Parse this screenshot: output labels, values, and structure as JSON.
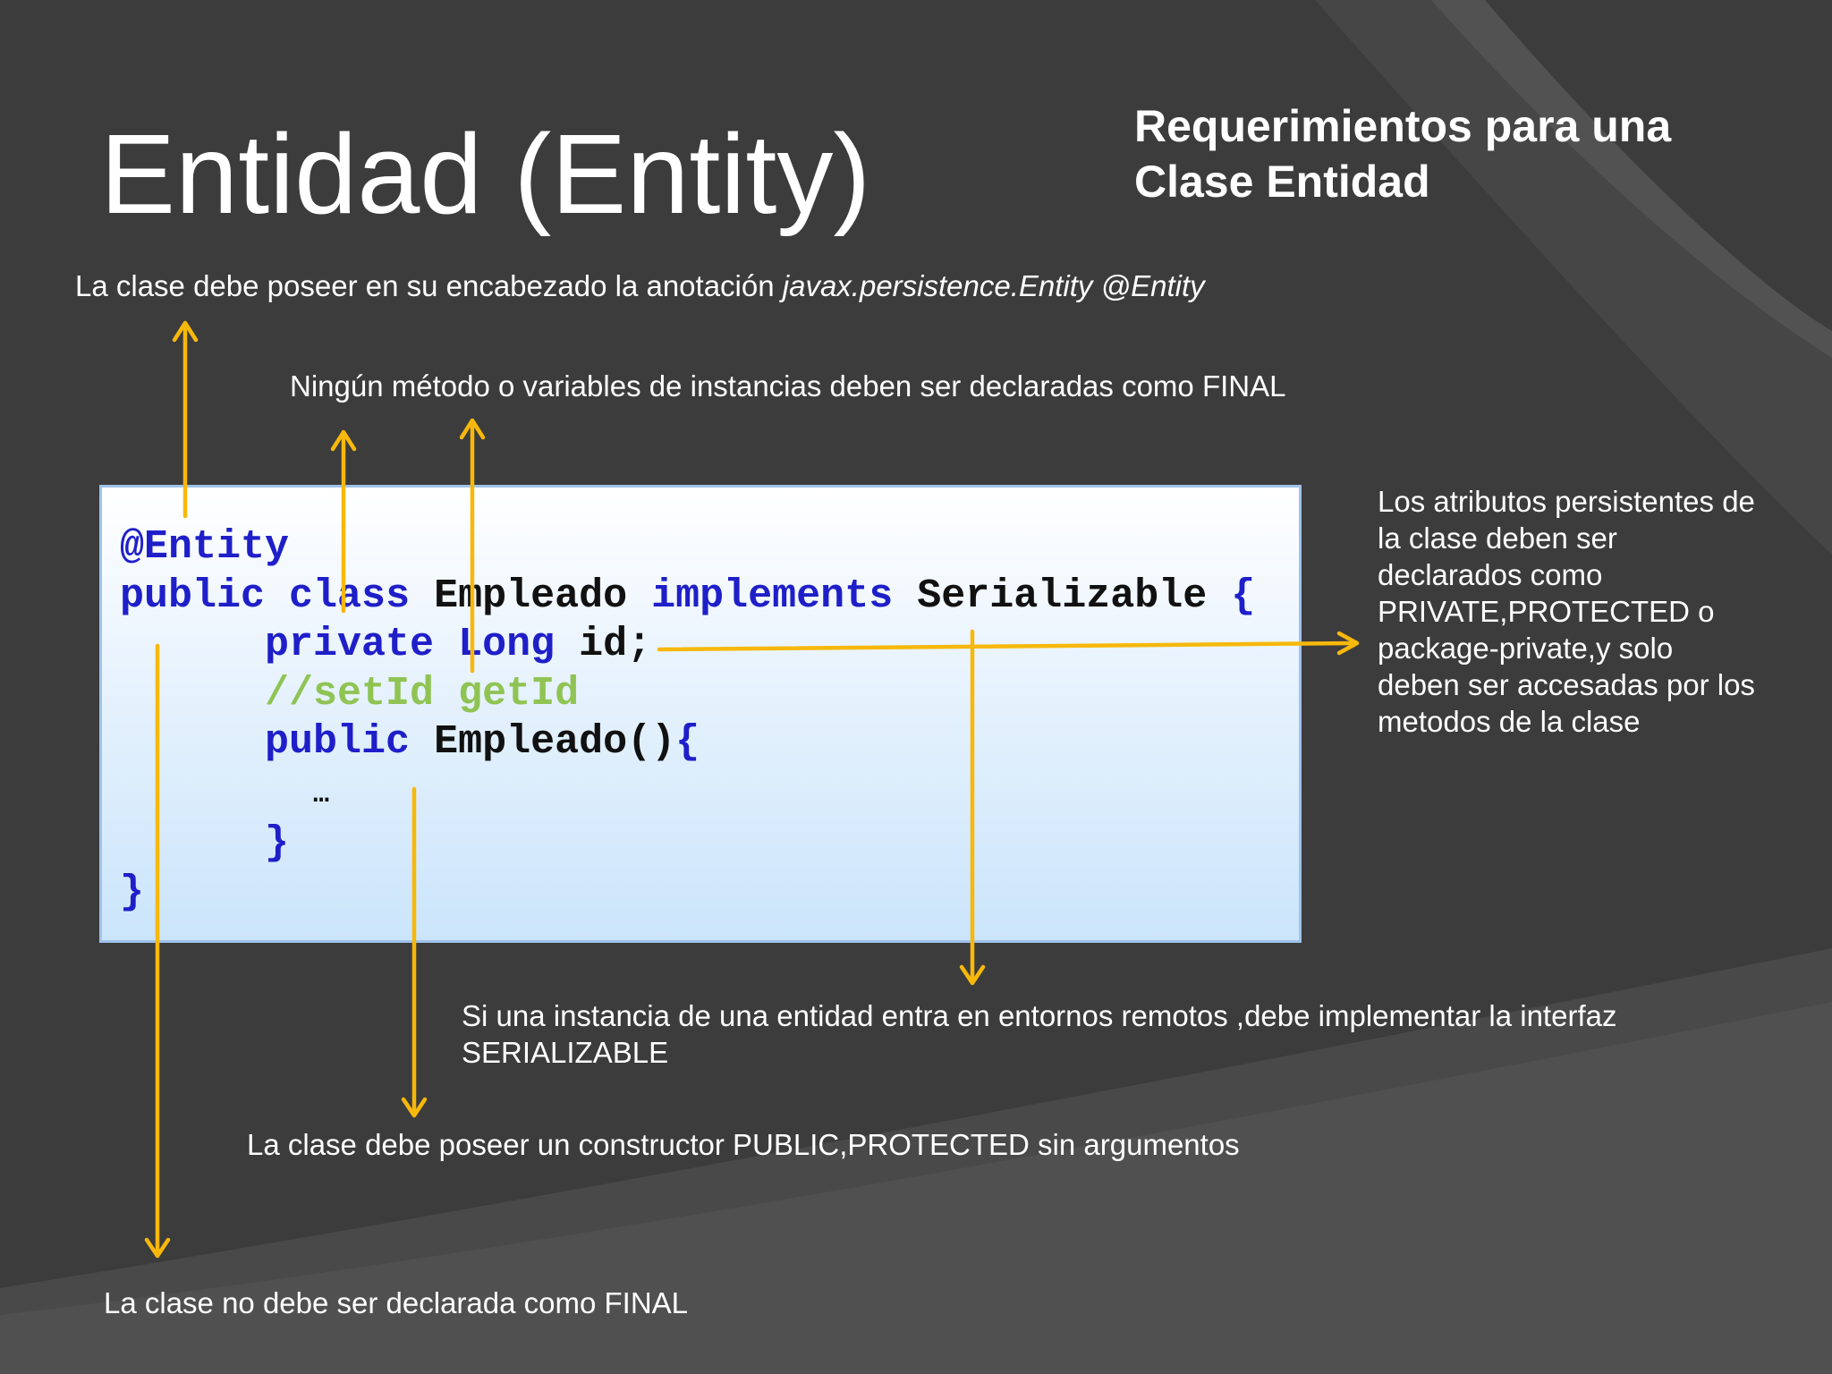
{
  "slide": {
    "title": "Entidad (Entity)",
    "subtitle_line1": "Requerimientos para una",
    "subtitle_line2": "Clase Entidad"
  },
  "notes": {
    "annotation": {
      "plain": "La clase debe poseer en su encabezado la anotación ",
      "italic": "javax.persistence.Entity @Entity"
    },
    "no_final_methods": "Ningún método o variables de instancias deben ser declaradas como FINAL",
    "persistent_attributes": {
      "line1": "Los atributos persistentes de",
      "line2": "la clase deben ser",
      "line3": "declarados como",
      "line4": "PRIVATE,PROTECTED o",
      "line5": "package-private,y solo",
      "line6": "deben ser accesadas por los",
      "line7": "metodos de la clase"
    },
    "serializable": {
      "line1": "Si una instancia de una entidad entra en entornos remotos ,debe implementar la interfaz",
      "line2": "SERIALIZABLE"
    },
    "constructor": "La clase debe poseer un constructor PUBLIC,PROTECTED sin argumentos",
    "class_not_final": "La clase no debe ser declarada como FINAL"
  },
  "code": {
    "annotation": "@Entity",
    "kw_public": "public",
    "kw_class": "class",
    "class_name": "Empleado",
    "kw_implements": "implements",
    "interface_name": "Serializable",
    "open_brace": "{",
    "kw_private": "private",
    "kw_long": "Long",
    "field": "id;",
    "comment": "//setId getId",
    "constructor_name": "Empleado()",
    "ellipsis": "…",
    "close_brace": "}"
  },
  "colors": {
    "background": "#3c3c3d",
    "arrow": "#f7b80b",
    "keyword": "#1f1fc9",
    "comment": "#8fc454",
    "code_box_border": "#9fc3ea"
  }
}
